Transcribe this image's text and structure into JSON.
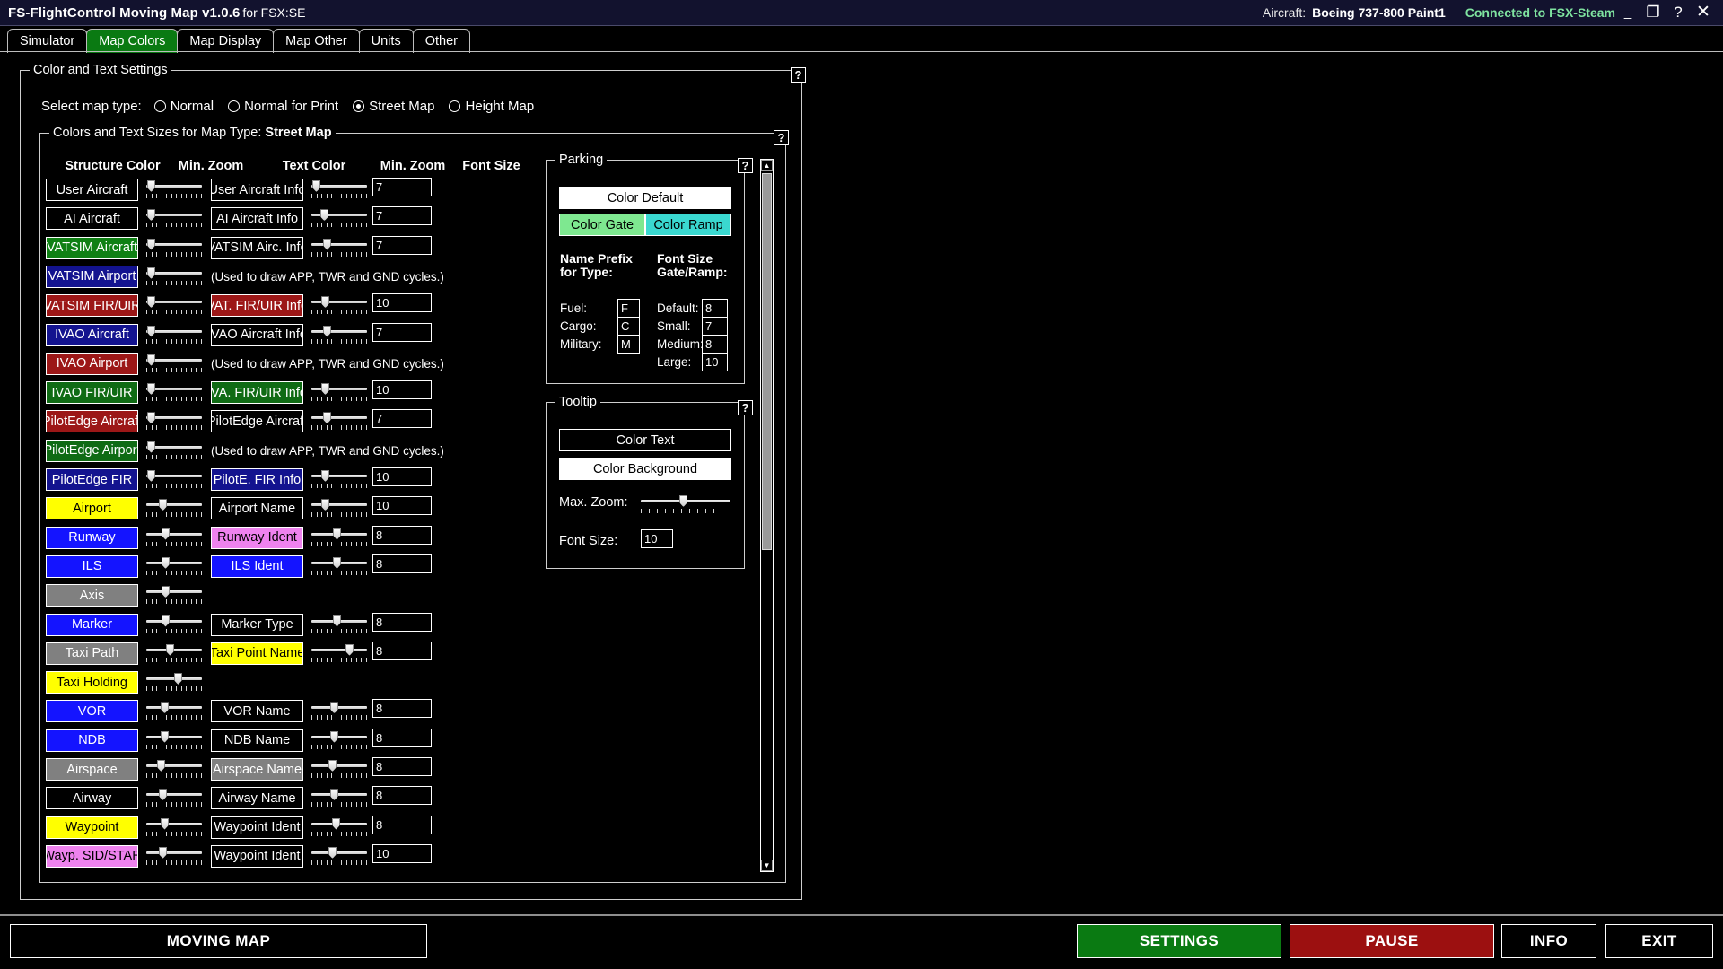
{
  "titlebar": {
    "app_title": "FS-FlightControl Moving Map v1.0.6",
    "app_subtitle": "for FSX:SE",
    "aircraft_label": "Aircraft:",
    "aircraft_value": "Boeing 737-800 Paint1",
    "connection_status": "Connected to FSX-Steam",
    "minimize": "_",
    "restore": "❐",
    "help": "?",
    "close": "✕"
  },
  "tabs": [
    {
      "label": "Simulator",
      "active": false
    },
    {
      "label": "Map Colors",
      "active": true
    },
    {
      "label": "Map Display",
      "active": false
    },
    {
      "label": "Map Other",
      "active": false
    },
    {
      "label": "Units",
      "active": false
    },
    {
      "label": "Other",
      "active": false
    }
  ],
  "outer_group": {
    "legend": "Color and Text Settings",
    "help": "?"
  },
  "maptype": {
    "label": "Select map type:",
    "options": [
      {
        "label": "Normal",
        "selected": false
      },
      {
        "label": "Normal for Print",
        "selected": false
      },
      {
        "label": "Street Map",
        "selected": true
      },
      {
        "label": "Height Map",
        "selected": false
      }
    ]
  },
  "inner_group": {
    "legend_prefix": "Colors and Text Sizes for Map Type: ",
    "legend_value": "Street Map",
    "help": "?"
  },
  "columns": {
    "structure_color": "Structure Color",
    "min_zoom_1": "Min. Zoom",
    "text_color": "Text Color",
    "min_zoom_2": "Min. Zoom",
    "font_size": "Font Size"
  },
  "cycles_note": "(Used to draw APP, TWR and GND cycles.)",
  "structure_rows": [
    {
      "label": "User Aircraft",
      "bg": "#000000",
      "fg": "#ffffff",
      "zoom": 0.02
    },
    {
      "label": "AI Aircraft",
      "bg": "#000000",
      "fg": "#ffffff",
      "zoom": 0.02
    },
    {
      "label": "VATSIM Aircraft",
      "bg": "#0f8014",
      "fg": "#ffffff",
      "zoom": 0.02
    },
    {
      "label": "VATSIM Airport",
      "bg": "#13138f",
      "fg": "#ffffff",
      "zoom": 0.02
    },
    {
      "label": "VATSIM FIR/UIR",
      "bg": "#9c1717",
      "fg": "#ffffff",
      "zoom": 0.02
    },
    {
      "label": "IVAO Aircraft",
      "bg": "#13138f",
      "fg": "#ffffff",
      "zoom": 0.02
    },
    {
      "label": "IVAO Airport",
      "bg": "#9c1717",
      "fg": "#ffffff",
      "zoom": 0.02
    },
    {
      "label": "IVAO FIR/UIR",
      "bg": "#0f6b14",
      "fg": "#ffffff",
      "zoom": 0.02
    },
    {
      "label": "PilotEdge Aircraft",
      "bg": "#9c1717",
      "fg": "#ffffff",
      "zoom": 0.02
    },
    {
      "label": "PilotEdge Airport",
      "bg": "#0f6b14",
      "fg": "#ffffff",
      "zoom": 0.02
    },
    {
      "label": "PilotEdge FIR",
      "bg": "#13138f",
      "fg": "#ffffff",
      "zoom": 0.02
    },
    {
      "label": "Airport",
      "bg": "#ffff00",
      "fg": "#000000",
      "zoom": 0.26
    },
    {
      "label": "Runway",
      "bg": "#1414ff",
      "fg": "#ffffff",
      "zoom": 0.33
    },
    {
      "label": "ILS",
      "bg": "#1414ff",
      "fg": "#ffffff",
      "zoom": 0.33
    },
    {
      "label": "Axis",
      "bg": "#808080",
      "fg": "#ffffff",
      "zoom": 0.33
    },
    {
      "label": "Marker",
      "bg": "#1414ff",
      "fg": "#ffffff",
      "zoom": 0.33
    },
    {
      "label": "Taxi Path",
      "bg": "#808080",
      "fg": "#ffffff",
      "zoom": 0.42
    },
    {
      "label": "Taxi Holding",
      "bg": "#ffff00",
      "fg": "#000000",
      "zoom": 0.58
    },
    {
      "label": "VOR",
      "bg": "#1414ff",
      "fg": "#ffffff",
      "zoom": 0.3
    },
    {
      "label": "NDB",
      "bg": "#1414ff",
      "fg": "#ffffff",
      "zoom": 0.3
    },
    {
      "label": "Airspace",
      "bg": "#808080",
      "fg": "#ffffff",
      "zoom": 0.23
    },
    {
      "label": "Airway",
      "bg": "#000000",
      "fg": "#ffffff",
      "zoom": 0.27
    },
    {
      "label": "Waypoint",
      "bg": "#ffff00",
      "fg": "#000000",
      "zoom": 0.3
    },
    {
      "label": "Wayp. SID/STAR",
      "bg": "#ee82ee",
      "fg": "#000000",
      "zoom": 0.27
    }
  ],
  "text_rows": [
    {
      "kind": "btn",
      "label": "User Aircraft Info",
      "bg": "#000000",
      "fg": "#ffffff",
      "zoom": 0.02,
      "font": "7"
    },
    {
      "kind": "btn",
      "label": "AI Aircraft Info",
      "bg": "#000000",
      "fg": "#ffffff",
      "zoom": 0.18,
      "font": "7"
    },
    {
      "kind": "btn",
      "label": "VATSIM Airc. Info",
      "bg": "#000000",
      "fg": "#ffffff",
      "zoom": 0.25,
      "font": "7"
    },
    {
      "kind": "note",
      "label": "(Used to draw APP, TWR and GND cycles.)"
    },
    {
      "kind": "btn",
      "label": "VAT. FIR/UIR Info",
      "bg": "#9c1717",
      "fg": "#ffffff",
      "zoom": 0.21,
      "font": "10"
    },
    {
      "kind": "btn",
      "label": "IVAO Aircraft Info",
      "bg": "#000000",
      "fg": "#ffffff",
      "zoom": 0.25,
      "font": "7"
    },
    {
      "kind": "note",
      "label": "(Used to draw APP, TWR and GND cycles.)"
    },
    {
      "kind": "btn",
      "label": "IVA. FIR/UIR Info",
      "bg": "#0f6b14",
      "fg": "#ffffff",
      "zoom": 0.21,
      "font": "10"
    },
    {
      "kind": "btn",
      "label": "PilotEdge Aircraft",
      "bg": "#000000",
      "fg": "#ffffff",
      "zoom": 0.25,
      "font": "7"
    },
    {
      "kind": "note",
      "label": "(Used to draw APP, TWR and GND cycles.)"
    },
    {
      "kind": "btn",
      "label": "PilotE. FIR Info",
      "bg": "#13138f",
      "fg": "#ffffff",
      "zoom": 0.21,
      "font": "10"
    },
    {
      "kind": "btn",
      "label": "Airport Name",
      "bg": "#000000",
      "fg": "#ffffff",
      "zoom": 0.21,
      "font": "10"
    },
    {
      "kind": "btn",
      "label": "Runway Ident",
      "bg": "#ee82ee",
      "fg": "#000000",
      "zoom": 0.45,
      "font": "8"
    },
    {
      "kind": "btn",
      "label": "ILS Ident",
      "bg": "#1414ff",
      "fg": "#ffffff",
      "zoom": 0.45,
      "font": "8"
    },
    {
      "kind": "gap"
    },
    {
      "kind": "btn",
      "label": "Marker Type",
      "bg": "#000000",
      "fg": "#ffffff",
      "zoom": 0.45,
      "font": "8"
    },
    {
      "kind": "btn",
      "label": "Taxi Point Name",
      "bg": "#ffff00",
      "fg": "#000000",
      "zoom": 0.72,
      "font": "8"
    },
    {
      "kind": "gap"
    },
    {
      "kind": "btn",
      "label": "VOR Name",
      "bg": "#000000",
      "fg": "#ffffff",
      "zoom": 0.4,
      "font": "8"
    },
    {
      "kind": "btn",
      "label": "NDB Name",
      "bg": "#000000",
      "fg": "#ffffff",
      "zoom": 0.4,
      "font": "8"
    },
    {
      "kind": "btn",
      "label": "Airspace Name",
      "bg": "#808080",
      "fg": "#ffffff",
      "zoom": 0.36,
      "font": "8"
    },
    {
      "kind": "btn",
      "label": "Airway Name",
      "bg": "#000000",
      "fg": "#ffffff",
      "zoom": 0.4,
      "font": "8"
    },
    {
      "kind": "btn",
      "label": "Waypoint Ident",
      "bg": "#000000",
      "fg": "#ffffff",
      "zoom": 0.43,
      "font": "8"
    },
    {
      "kind": "btn",
      "label": "Waypoint Ident",
      "bg": "#000000",
      "fg": "#ffffff",
      "zoom": 0.36,
      "font": "10"
    }
  ],
  "parking": {
    "legend": "Parking",
    "help": "?",
    "color_default": {
      "label": "Color Default",
      "bg": "#ffffff",
      "fg": "#000000"
    },
    "color_gate": {
      "label": "Color Gate",
      "bg": "#7ee890",
      "fg": "#000000"
    },
    "color_ramp": {
      "label": "Color Ramp",
      "bg": "#3ad8d0",
      "fg": "#000000"
    },
    "name_prefix_heading_l1": "Name Prefix",
    "name_prefix_heading_l2": "for Type:",
    "font_size_heading_l1": "Font Size",
    "font_size_heading_l2": "Gate/Ramp:",
    "prefix_fields": [
      {
        "label": "Fuel:",
        "value": "F"
      },
      {
        "label": "Cargo:",
        "value": "C"
      },
      {
        "label": "Military:",
        "value": "M"
      }
    ],
    "size_fields": [
      {
        "label": "Default:",
        "value": "8"
      },
      {
        "label": "Small:",
        "value": "7"
      },
      {
        "label": "Medium:",
        "value": "8"
      },
      {
        "label": "Large:",
        "value": "10"
      }
    ]
  },
  "tooltip": {
    "legend": "Tooltip",
    "help": "?",
    "color_text": {
      "label": "Color Text",
      "bg": "#000000",
      "fg": "#ffffff"
    },
    "color_background": {
      "label": "Color Background",
      "bg": "#ffffff",
      "fg": "#000000"
    },
    "max_zoom_label": "Max. Zoom:",
    "max_zoom_value": 0.47,
    "font_size_label": "Font Size:",
    "font_size_value": "10"
  },
  "bottom_bar": {
    "moving_map": {
      "label": "MOVING MAP",
      "bg": "#000000",
      "fg": "#ffffff"
    },
    "settings": {
      "label": "SETTINGS",
      "bg": "#0a7a12",
      "fg": "#ffffff"
    },
    "pause": {
      "label": "PAUSE",
      "bg": "#9c1010",
      "fg": "#ffffff"
    },
    "info": {
      "label": "INFO",
      "bg": "#000000",
      "fg": "#ffffff"
    },
    "exit": {
      "label": "EXIT",
      "bg": "#000000",
      "fg": "#ffffff"
    }
  }
}
